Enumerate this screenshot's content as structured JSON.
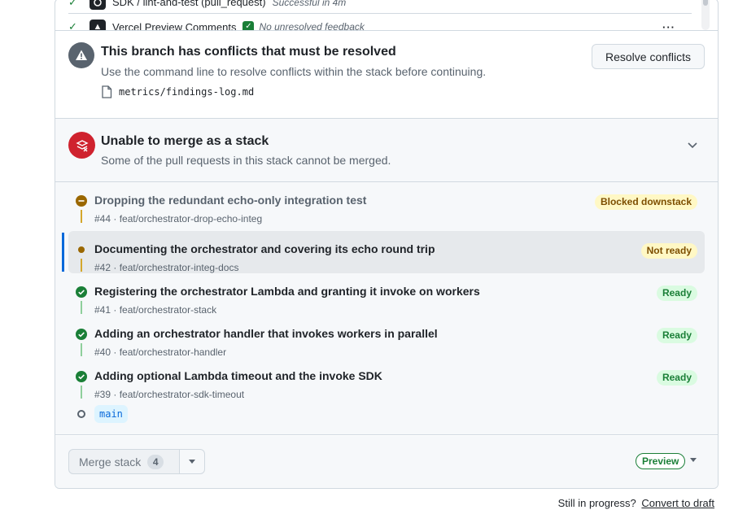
{
  "checks": [
    {
      "app_icon": "github-actions-icon",
      "name": "SDK / lint-and-test (pull_request)",
      "status": "Successful in 4m"
    },
    {
      "app_icon": "vercel-icon",
      "name": "Vercel Preview Comments",
      "status": "No unresolved feedback"
    }
  ],
  "conflict": {
    "title": "This branch has conflicts that must be resolved",
    "description": "Use the command line to resolve conflicts within the stack before continuing.",
    "file": "metrics/findings-log.md",
    "resolve_label": "Resolve conflicts"
  },
  "stack": {
    "title": "Unable to merge as a stack",
    "description": "Some of the pull requests in this stack cannot be merged."
  },
  "pull_requests": [
    {
      "title": "Dropping the redundant echo-only integration test",
      "number": "#44",
      "branch": "feat/orchestrator-drop-echo-integ",
      "status": "Blocked downstack"
    },
    {
      "title": "Documenting the orchestrator and covering its echo round trip",
      "number": "#42",
      "branch": "feat/orchestrator-integ-docs",
      "status": "Not ready"
    },
    {
      "title": "Registering the orchestrator Lambda and granting it invoke on workers",
      "number": "#41",
      "branch": "feat/orchestrator-stack",
      "status": "Ready"
    },
    {
      "title": "Adding an orchestrator handler that invokes workers in parallel",
      "number": "#40",
      "branch": "feat/orchestrator-handler",
      "status": "Ready"
    },
    {
      "title": "Adding optional Lambda timeout and the invoke SDK",
      "number": "#39",
      "branch": "feat/orchestrator-sdk-timeout",
      "status": "Ready"
    }
  ],
  "base_branch": "main",
  "footer": {
    "merge_label": "Merge stack",
    "merge_count": "4",
    "preview_label": "Preview"
  },
  "note": {
    "text": "Still in progress?",
    "link": "Convert to draft"
  },
  "colors": {
    "ready": "#1a7f37",
    "warning": "#9a6700",
    "danger": "#cf222e",
    "accent": "#0969da"
  }
}
